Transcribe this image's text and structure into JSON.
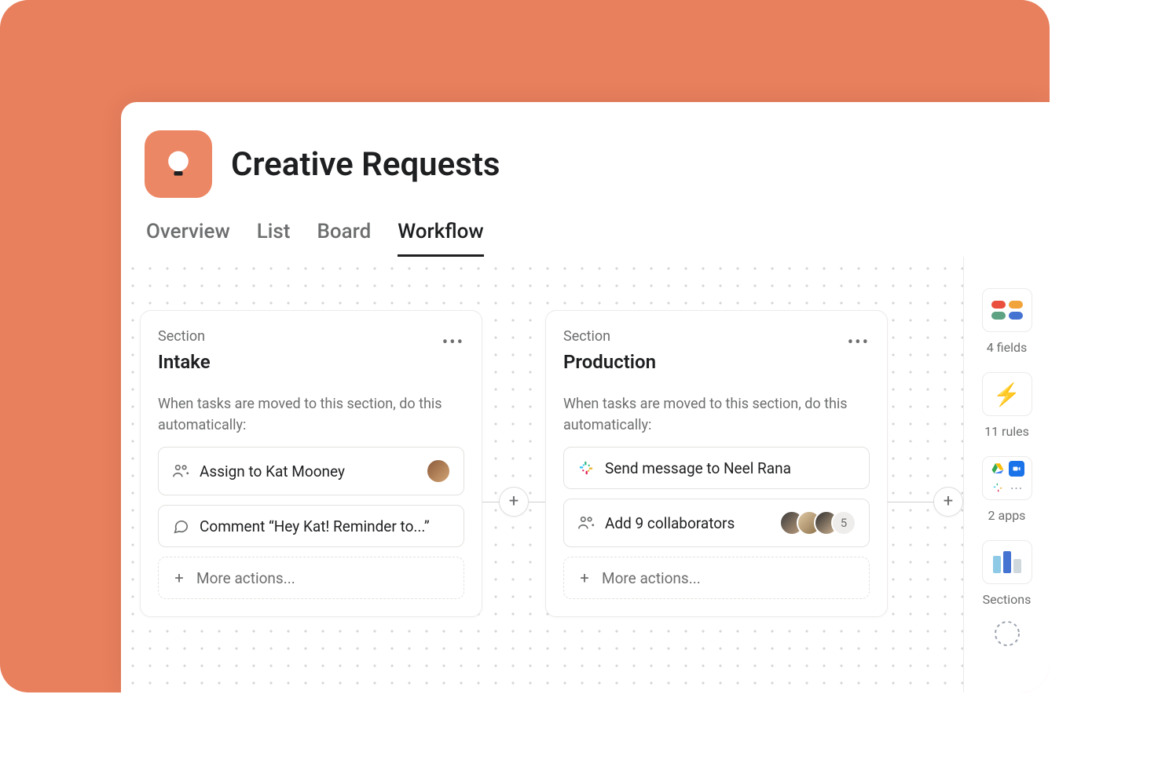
{
  "project": {
    "title": "Creative Requests",
    "icon_color": "#ec8765"
  },
  "tabs": [
    {
      "label": "Overview",
      "active": false
    },
    {
      "label": "List",
      "active": false
    },
    {
      "label": "Board",
      "active": false
    },
    {
      "label": "Workflow",
      "active": true
    }
  ],
  "sections": [
    {
      "label": "Section",
      "name": "Intake",
      "description": "When tasks are moved to this section, do this automatically:",
      "rules": [
        {
          "icon": "assign",
          "text": "Assign to Kat Mooney",
          "avatar": true
        },
        {
          "icon": "comment",
          "text": "Comment “Hey Kat! Reminder to...”"
        }
      ],
      "more_label": "More actions..."
    },
    {
      "label": "Section",
      "name": "Production",
      "description": "When tasks are moved to this section, do this automatically:",
      "rules": [
        {
          "icon": "slack",
          "text": "Send message to Neel Rana"
        },
        {
          "icon": "collaborators",
          "text": "Add 9 collaborators",
          "avatars": 3,
          "more_count": "5"
        }
      ],
      "more_label": "More actions..."
    }
  ],
  "right_panel": {
    "fields_label": "4 fields",
    "rules_label": "11 rules",
    "apps_label": "2 apps",
    "sections_label": "Sections"
  },
  "plus_label": "+"
}
